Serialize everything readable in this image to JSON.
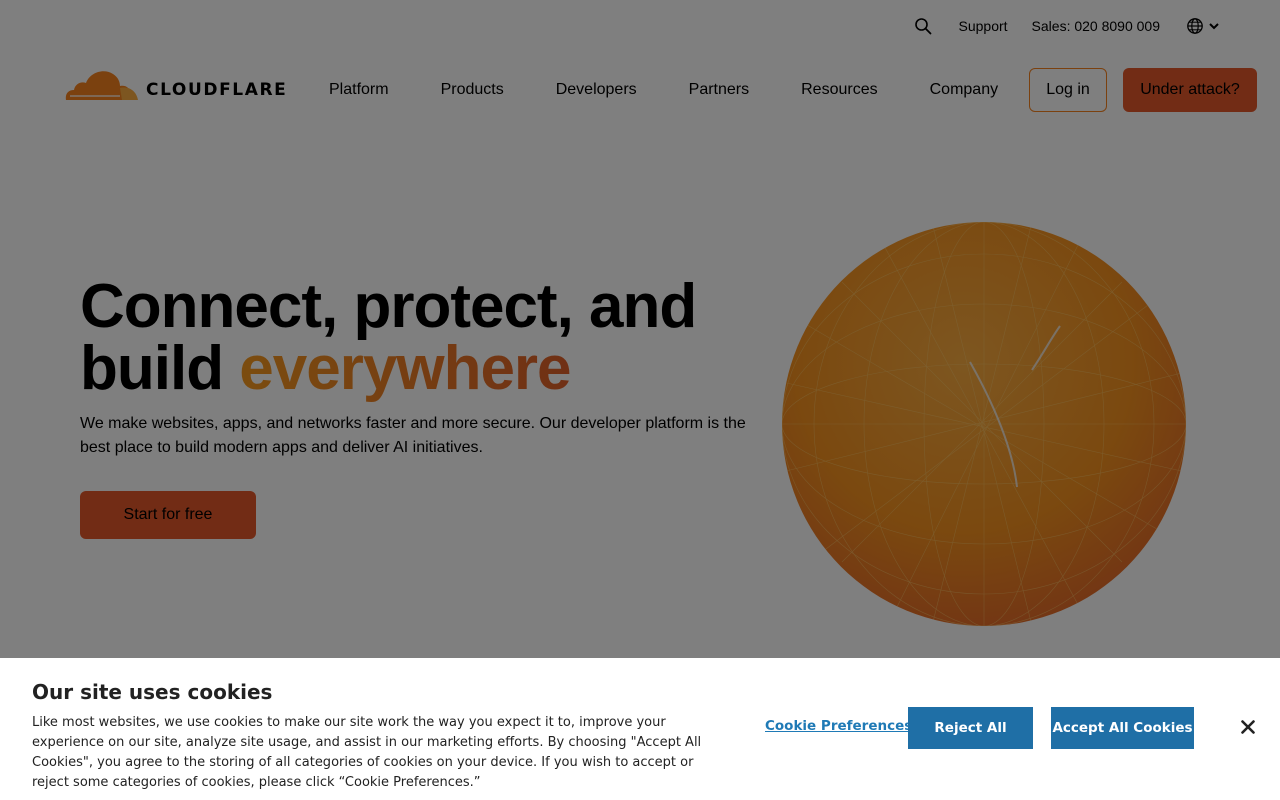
{
  "utility_bar": {
    "search_icon": "search-icon",
    "support_label": "Support",
    "sales_label": "Sales: 020 8090 009",
    "language_icon": "globe-icon"
  },
  "header": {
    "logo_text": "CLOUDFLARE",
    "nav": [
      "Platform",
      "Products",
      "Developers",
      "Partners",
      "Resources",
      "Company"
    ],
    "login_label": "Log in",
    "attack_label": "Under attack?"
  },
  "hero": {
    "title_line1": "Connect, protect, and",
    "title_line2_plain": "build ",
    "title_line2_accent": "everywhere",
    "subtitle": "We make websites, apps, and networks faster and more secure. Our developer platform is the best place to build modern apps and deliver AI initiatives.",
    "cta_label": "Start for free"
  },
  "cookie_banner": {
    "title": "Our site uses cookies",
    "text": "Like most websites, we use cookies to make our site work the way you expect it to, improve your experience on our site, analyze site usage, and assist in our marketing efforts. By choosing \"Accept All Cookies\", you agree to the storing of all categories of cookies on your device. If you wish to accept or reject some categories of cookies, please click “Cookie Preferences.”",
    "preferences_label": "Cookie Preferences",
    "reject_label": "Reject All",
    "accept_label": "Accept All Cookies",
    "close_icon": "close-icon"
  },
  "colors": {
    "brand_orange": "#f6821f",
    "cta_orange": "#e4582a",
    "cookie_button": "#1f6fa6",
    "overlay": "rgba(0,0,0,0.5)"
  }
}
